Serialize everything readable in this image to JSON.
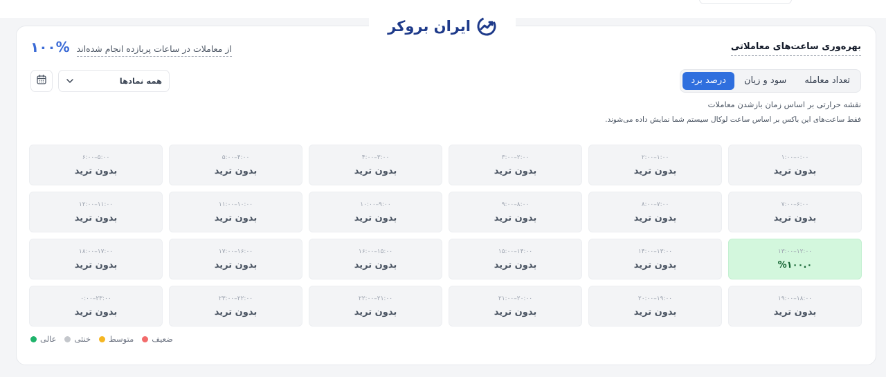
{
  "brand": {
    "name": "ایران بروکر"
  },
  "header": {
    "title": "بهره‌وری ساعت‌های معاملاتی",
    "summary_pct": "۱۰۰%",
    "summary_text": "از معاملات در ساعات پربازده انجام شده‌اند"
  },
  "tabs": [
    {
      "label": "تعداد معامله",
      "active": false
    },
    {
      "label": "سود و زیان",
      "active": false
    },
    {
      "label": "درصد برد",
      "active": true
    }
  ],
  "filter": {
    "symbol_select": "همه نمادها"
  },
  "description": {
    "line1": "نقشه حرارتی بر اساس زمان بازشدن معاملات",
    "line2": "فقط ساعت‌های این باکس بر اساس ساعت لوکال سیستم شما نمایش داده می‌شوند."
  },
  "hours": [
    {
      "range": "۰:۰۰–۱:۰۰",
      "value": "بدون ترید",
      "status": "none"
    },
    {
      "range": "۱:۰۰–۲:۰۰",
      "value": "بدون ترید",
      "status": "none"
    },
    {
      "range": "۲:۰۰–۳:۰۰",
      "value": "بدون ترید",
      "status": "none"
    },
    {
      "range": "۳:۰۰–۴:۰۰",
      "value": "بدون ترید",
      "status": "none"
    },
    {
      "range": "۴:۰۰–۵:۰۰",
      "value": "بدون ترید",
      "status": "none"
    },
    {
      "range": "۵:۰۰–۶:۰۰",
      "value": "بدون ترید",
      "status": "none"
    },
    {
      "range": "۶:۰۰–۷:۰۰",
      "value": "بدون ترید",
      "status": "none"
    },
    {
      "range": "۷:۰۰–۸:۰۰",
      "value": "بدون ترید",
      "status": "none"
    },
    {
      "range": "۸:۰۰–۹:۰۰",
      "value": "بدون ترید",
      "status": "none"
    },
    {
      "range": "۹:۰۰–۱۰:۰۰",
      "value": "بدون ترید",
      "status": "none"
    },
    {
      "range": "۱۰:۰۰–۱۱:۰۰",
      "value": "بدون ترید",
      "status": "none"
    },
    {
      "range": "۱۱:۰۰–۱۲:۰۰",
      "value": "بدون ترید",
      "status": "none"
    },
    {
      "range": "۱۲:۰۰–۱۳:۰۰",
      "value": "%۱۰۰.۰",
      "status": "high"
    },
    {
      "range": "۱۳:۰۰–۱۴:۰۰",
      "value": "بدون ترید",
      "status": "none"
    },
    {
      "range": "۱۴:۰۰–۱۵:۰۰",
      "value": "بدون ترید",
      "status": "none"
    },
    {
      "range": "۱۵:۰۰–۱۶:۰۰",
      "value": "بدون ترید",
      "status": "none"
    },
    {
      "range": "۱۶:۰۰–۱۷:۰۰",
      "value": "بدون ترید",
      "status": "none"
    },
    {
      "range": "۱۷:۰۰–۱۸:۰۰",
      "value": "بدون ترید",
      "status": "none"
    },
    {
      "range": "۱۸:۰۰–۱۹:۰۰",
      "value": "بدون ترید",
      "status": "none"
    },
    {
      "range": "۱۹:۰۰–۲۰:۰۰",
      "value": "بدون ترید",
      "status": "none"
    },
    {
      "range": "۲۰:۰۰–۲۱:۰۰",
      "value": "بدون ترید",
      "status": "none"
    },
    {
      "range": "۲۱:۰۰–۲۲:۰۰",
      "value": "بدون ترید",
      "status": "none"
    },
    {
      "range": "۲۲:۰۰–۲۳:۰۰",
      "value": "بدون ترید",
      "status": "none"
    },
    {
      "range": "۲۳:۰۰–۰:۰۰",
      "value": "بدون ترید",
      "status": "none"
    }
  ],
  "legend": [
    {
      "label": "ضعیف",
      "color": "#f26b6b"
    },
    {
      "label": "متوسط",
      "color": "#f5b622"
    },
    {
      "label": "خنثی",
      "color": "#c4c7cc"
    },
    {
      "label": "عالی",
      "color": "#1fb36b"
    }
  ],
  "colors": {
    "accent": "#2f6fde",
    "brand": "#1e3a8a",
    "win_cell": "#d3f7dd"
  },
  "icons": {
    "select": "chevron-down-icon",
    "calendar": "calendar-icon",
    "logo": "trend-up-logo-icon"
  }
}
